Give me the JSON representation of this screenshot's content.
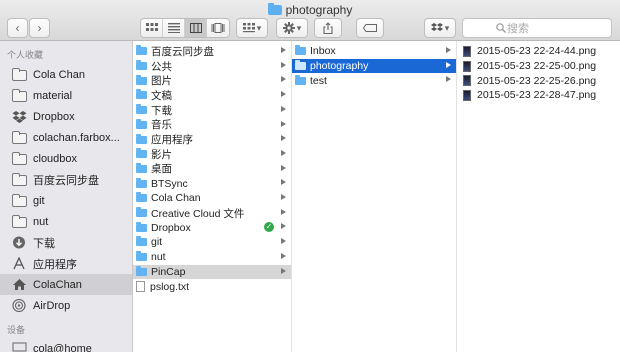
{
  "window": {
    "title": "photography"
  },
  "toolbar": {
    "back_glyph": "‹",
    "forward_glyph": "›",
    "view_icons": [
      "icon-view-icon",
      "list-view-icon",
      "column-view-icon",
      "coverflow-view-icon"
    ],
    "active_view": "column-view-icon",
    "arrange_caret": "▾",
    "action_caret": "▾",
    "dropbox_caret": "▾",
    "search_placeholder": "搜索"
  },
  "sidebar": {
    "favorites_heading": "个人收藏",
    "favorites": [
      {
        "label": "Cola Chan",
        "icon": "folder-icon"
      },
      {
        "label": "material",
        "icon": "folder-icon"
      },
      {
        "label": "Dropbox",
        "icon": "dropbox-icon"
      },
      {
        "label": "colachan.farbox...",
        "icon": "folder-icon"
      },
      {
        "label": "cloudbox",
        "icon": "folder-icon"
      },
      {
        "label": "百度云同步盘",
        "icon": "folder-icon"
      },
      {
        "label": "git",
        "icon": "folder-icon"
      },
      {
        "label": "nut",
        "icon": "folder-icon"
      },
      {
        "label": "下载",
        "icon": "download-icon"
      },
      {
        "label": "应用程序",
        "icon": "applications-icon"
      },
      {
        "label": "ColaChan",
        "icon": "home-icon",
        "selected": true
      },
      {
        "label": "AirDrop",
        "icon": "airdrop-icon"
      }
    ],
    "devices_heading": "设备",
    "devices": [
      {
        "label": "cola@home",
        "icon": "computer-icon"
      }
    ]
  },
  "column1": [
    {
      "label": "百度云同步盘",
      "kind": "folder",
      "arrow": true
    },
    {
      "label": "公共",
      "kind": "folder",
      "arrow": true
    },
    {
      "label": "图片",
      "kind": "folder",
      "arrow": true
    },
    {
      "label": "文稿",
      "kind": "folder",
      "arrow": true
    },
    {
      "label": "下载",
      "kind": "folder",
      "arrow": true
    },
    {
      "label": "音乐",
      "kind": "folder",
      "arrow": true
    },
    {
      "label": "应用程序",
      "kind": "folder",
      "arrow": true
    },
    {
      "label": "影片",
      "kind": "folder",
      "arrow": true
    },
    {
      "label": "桌面",
      "kind": "folder",
      "arrow": true
    },
    {
      "label": "BTSync",
      "kind": "folder",
      "arrow": true
    },
    {
      "label": "Cola Chan",
      "kind": "folder",
      "arrow": true
    },
    {
      "label": "Creative Cloud 文件",
      "kind": "folder",
      "arrow": true
    },
    {
      "label": "Dropbox",
      "kind": "folder",
      "arrow": true,
      "synced": true
    },
    {
      "label": "git",
      "kind": "folder",
      "arrow": true
    },
    {
      "label": "nut",
      "kind": "folder",
      "arrow": true
    },
    {
      "label": "PinCap",
      "kind": "folder",
      "arrow": true,
      "highlight": "gray"
    },
    {
      "label": "pslog.txt",
      "kind": "document",
      "arrow": false
    }
  ],
  "column2": [
    {
      "label": "Inbox",
      "kind": "folder",
      "arrow": true
    },
    {
      "label": "photography",
      "kind": "folder",
      "arrow": true,
      "highlight": "blue"
    },
    {
      "label": "test",
      "kind": "folder",
      "arrow": true
    }
  ],
  "column3": [
    {
      "label": "2015-05-23 22-24-44.png",
      "kind": "image"
    },
    {
      "label": "2015-05-23 22-25-00.png",
      "kind": "image"
    },
    {
      "label": "2015-05-23 22-25-26.png",
      "kind": "image"
    },
    {
      "label": "2015-05-23 22-28-47.png",
      "kind": "image"
    }
  ],
  "colors": {
    "selection_blue": "#1a68d6",
    "folder_blue": "#62b3f2",
    "sync_green": "#2fa84a"
  }
}
